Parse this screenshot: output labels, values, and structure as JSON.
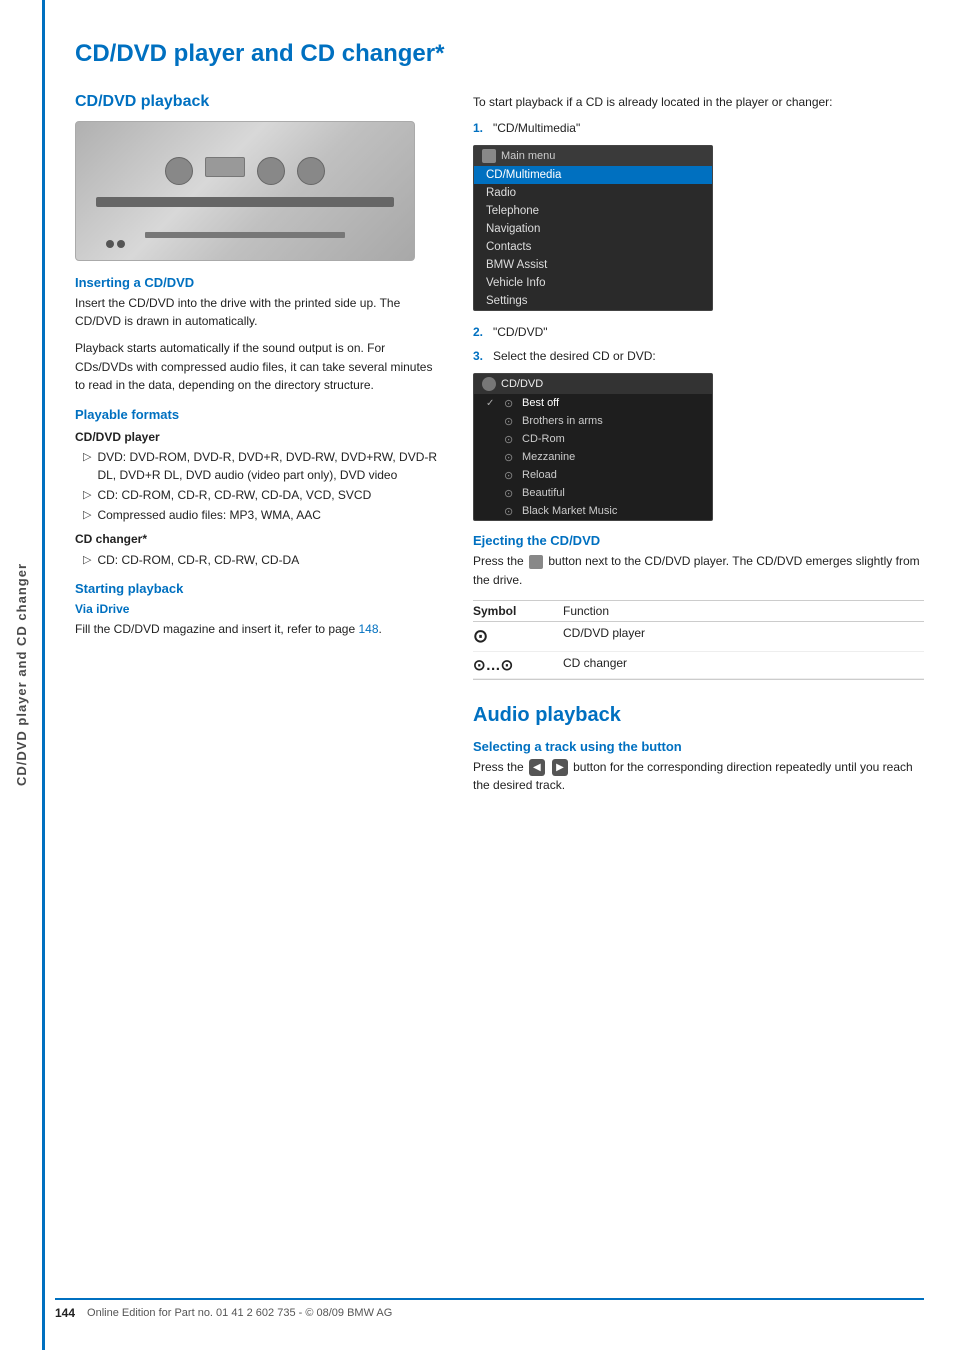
{
  "sidebar": {
    "text": "CD/DVD player and CD changer"
  },
  "page": {
    "title": "CD/DVD player and CD changer*",
    "footer_page_num": "144",
    "footer_text": "Online Edition for Part no. 01 41 2 602 735 - © 08/09 BMW AG"
  },
  "left_col": {
    "section_title": "CD/DVD playback",
    "inserting_title": "Inserting a CD/DVD",
    "inserting_text1": "Insert the CD/DVD into the drive with the printed side up. The CD/DVD is drawn in automatically.",
    "inserting_text2": "Playback starts automatically if the sound output is on. For CDs/DVDs with compressed audio files, it can take several minutes to read in the data, depending on the directory structure.",
    "playable_title": "Playable formats",
    "cd_dvd_player_label": "CD/DVD player",
    "dvd_item": "DVD: DVD-ROM, DVD-R, DVD+R, DVD-RW, DVD+RW, DVD-R DL, DVD+R DL, DVD audio (video part only), DVD video",
    "cd_item": "CD: CD-ROM, CD-R, CD-RW, CD-DA, VCD, SVCD",
    "compressed_item": "Compressed audio files: MP3, WMA, AAC",
    "cd_changer_label": "CD changer*",
    "cd_changer_item": "CD: CD-ROM, CD-R, CD-RW, CD-DA",
    "starting_title": "Starting playback",
    "via_idrive_title": "Via iDrive",
    "via_idrive_text": "Fill the CD/DVD magazine and insert it, refer to page ",
    "via_idrive_link": "148"
  },
  "right_col": {
    "playback_intro": "To start playback if a CD is already located in the player or changer:",
    "step1": "\"CD/Multimedia\"",
    "step2": "\"CD/DVD\"",
    "step3": "Select the desired CD or DVD:",
    "main_menu_label": "Main menu",
    "menu_items": [
      {
        "label": "CD/Multimedia",
        "active": true
      },
      {
        "label": "Radio",
        "active": false
      },
      {
        "label": "Telephone",
        "active": false
      },
      {
        "label": "Navigation",
        "active": false
      },
      {
        "label": "Contacts",
        "active": false
      },
      {
        "label": "BMW Assist",
        "active": false
      },
      {
        "label": "Vehicle Info",
        "active": false
      },
      {
        "label": "Settings",
        "active": false
      }
    ],
    "cddvd_label": "CD/DVD",
    "cddvd_items": [
      {
        "label": "Best off",
        "checked": true
      },
      {
        "label": "Brothers in arms",
        "checked": false
      },
      {
        "label": "CD-Rom",
        "checked": false
      },
      {
        "label": "Mezzanine",
        "checked": false
      },
      {
        "label": "Reload",
        "checked": false
      },
      {
        "label": "Beautiful",
        "checked": false
      },
      {
        "label": "Black Market Music",
        "checked": false
      }
    ],
    "ejecting_title": "Ejecting the CD/DVD",
    "ejecting_text": "Press the  button next to the CD/DVD player. The CD/DVD emerges slightly from the drive.",
    "table_header_symbol": "Symbol",
    "table_header_function": "Function",
    "table_rows": [
      {
        "symbol": "disc",
        "function": "CD/DVD player"
      },
      {
        "symbol": "cd-changer",
        "function": "CD changer"
      }
    ],
    "audio_section_title": "Audio playback",
    "selecting_title": "Selecting a track using the button",
    "selecting_text": "Press the  button for the corresponding direction repeatedly until you reach the desired track."
  }
}
